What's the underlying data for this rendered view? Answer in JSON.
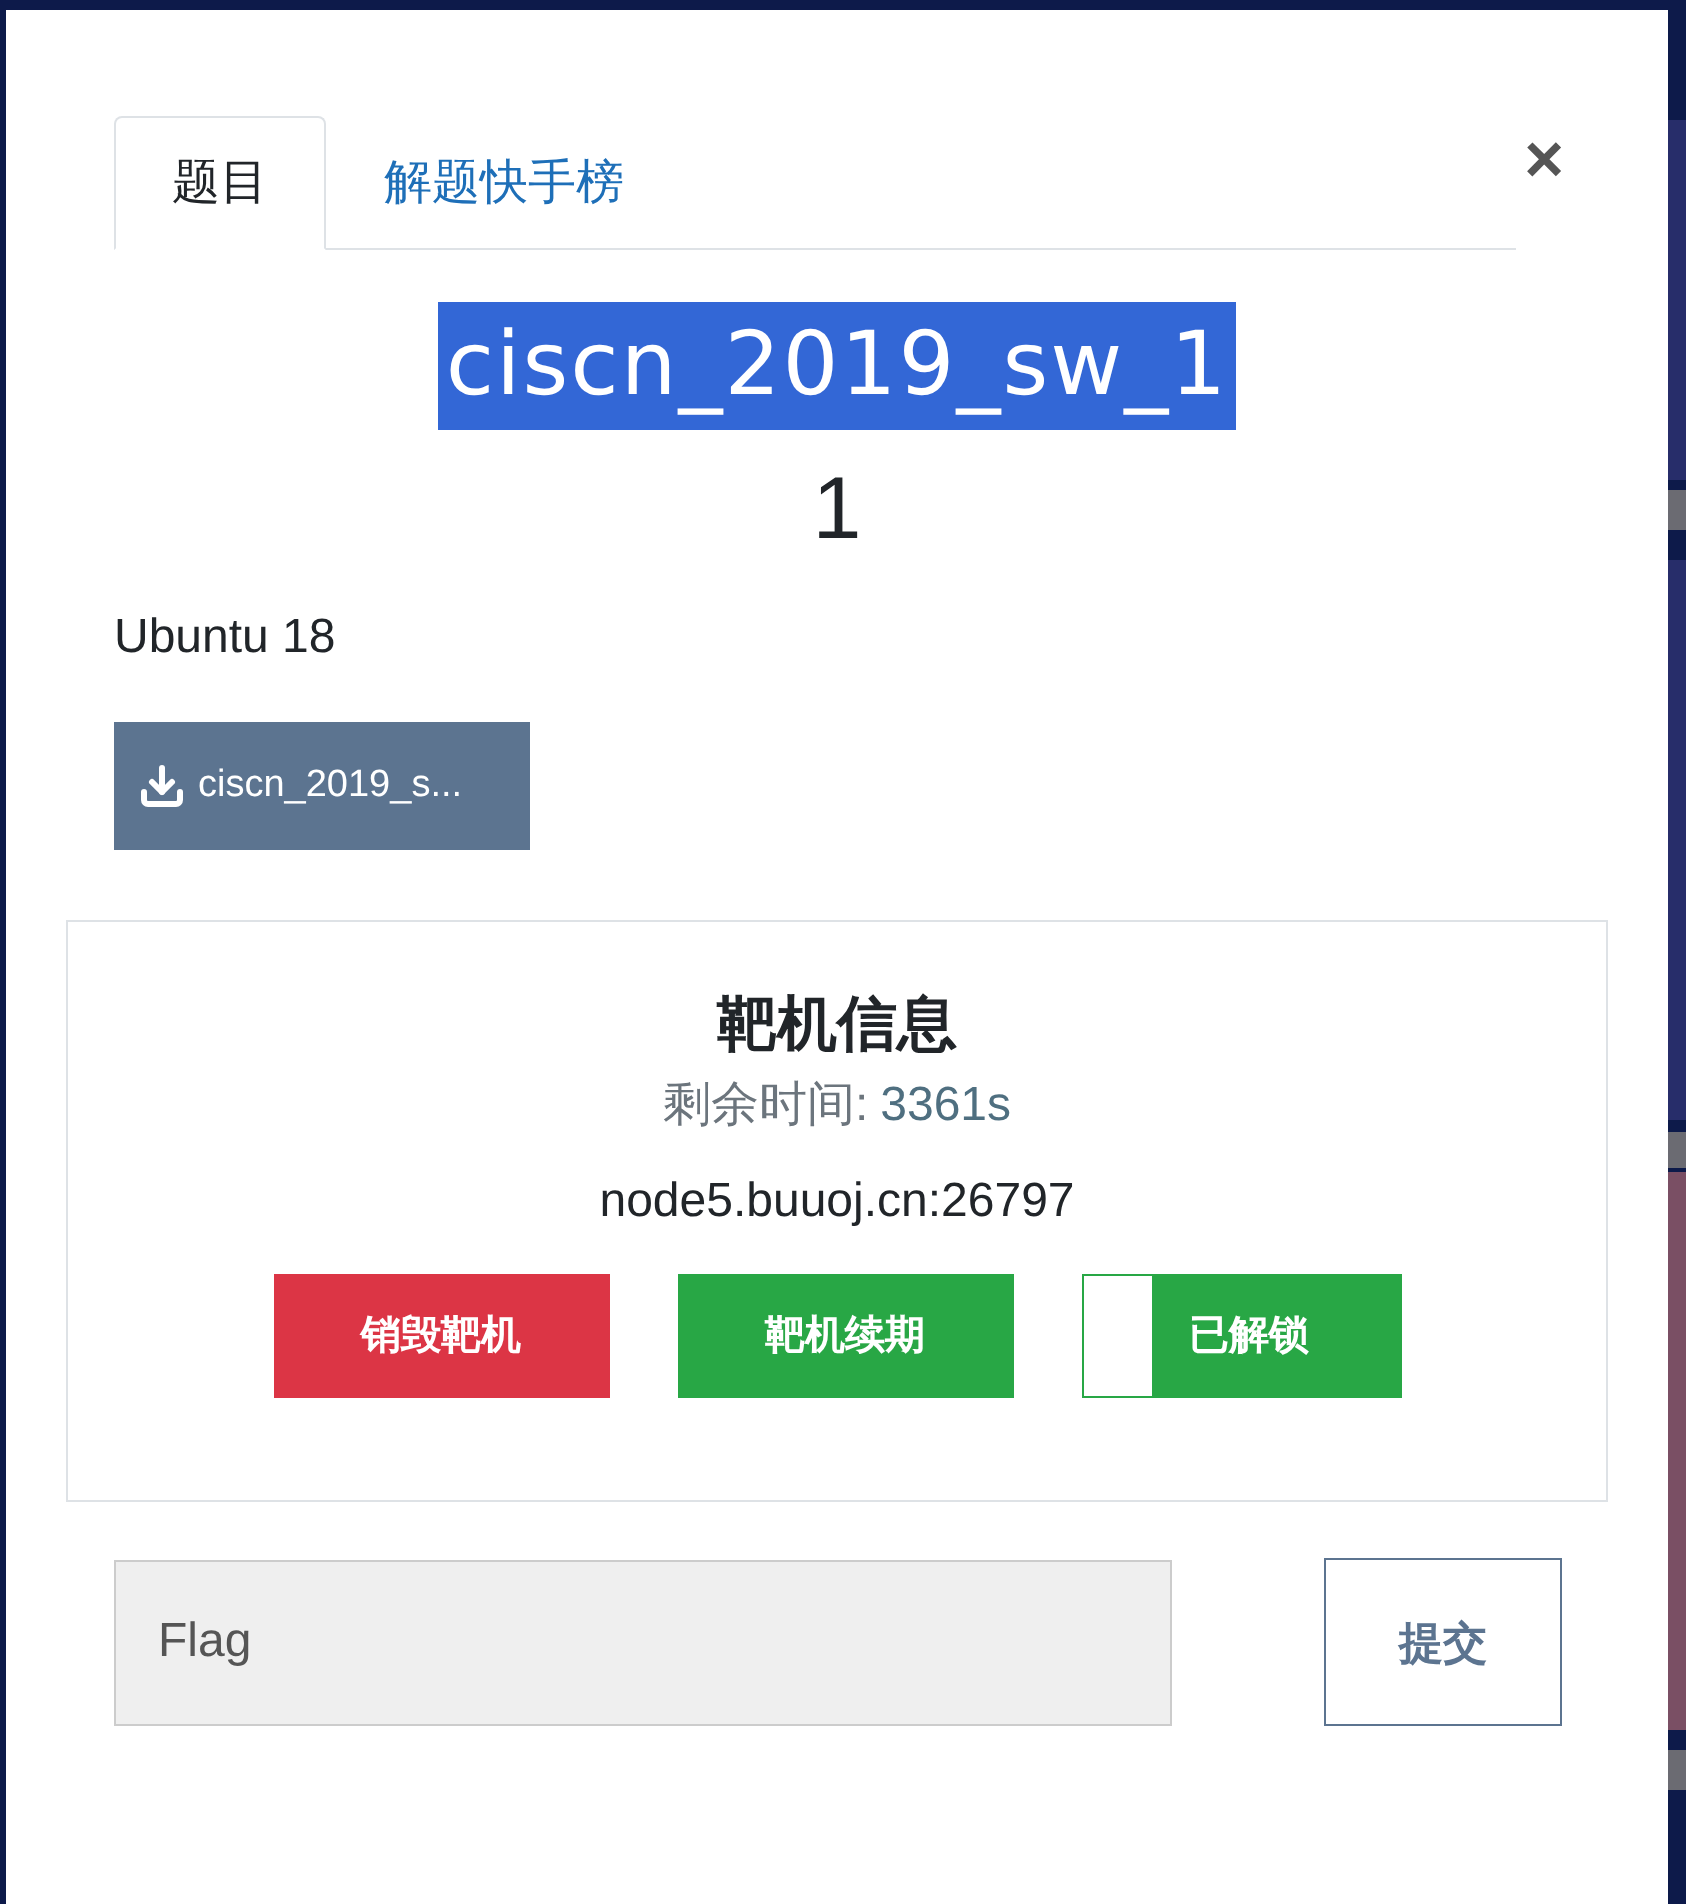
{
  "tabs": [
    {
      "label": "题目",
      "selected": true
    },
    {
      "label": "解题快手榜",
      "selected": false
    }
  ],
  "close": "×",
  "challenge": {
    "title": "ciscn_2019_sw_1",
    "title_selected": true,
    "score": "1",
    "description": "Ubuntu 18",
    "download": "ciscn_2019_s..."
  },
  "target": {
    "heading": "靶机信息",
    "time_label": "剩余时间:",
    "time_value": "3361s",
    "address": "node5.buuoj.cn:26797",
    "buttons": [
      {
        "kind": "danger",
        "label": "销毁靶机"
      },
      {
        "kind": "success",
        "label": "靶机续期"
      },
      {
        "kind": "progress",
        "label": "已解锁",
        "level": 0.78
      }
    ]
  },
  "flag": {
    "placeholder": "Flag",
    "submit": "提交"
  }
}
